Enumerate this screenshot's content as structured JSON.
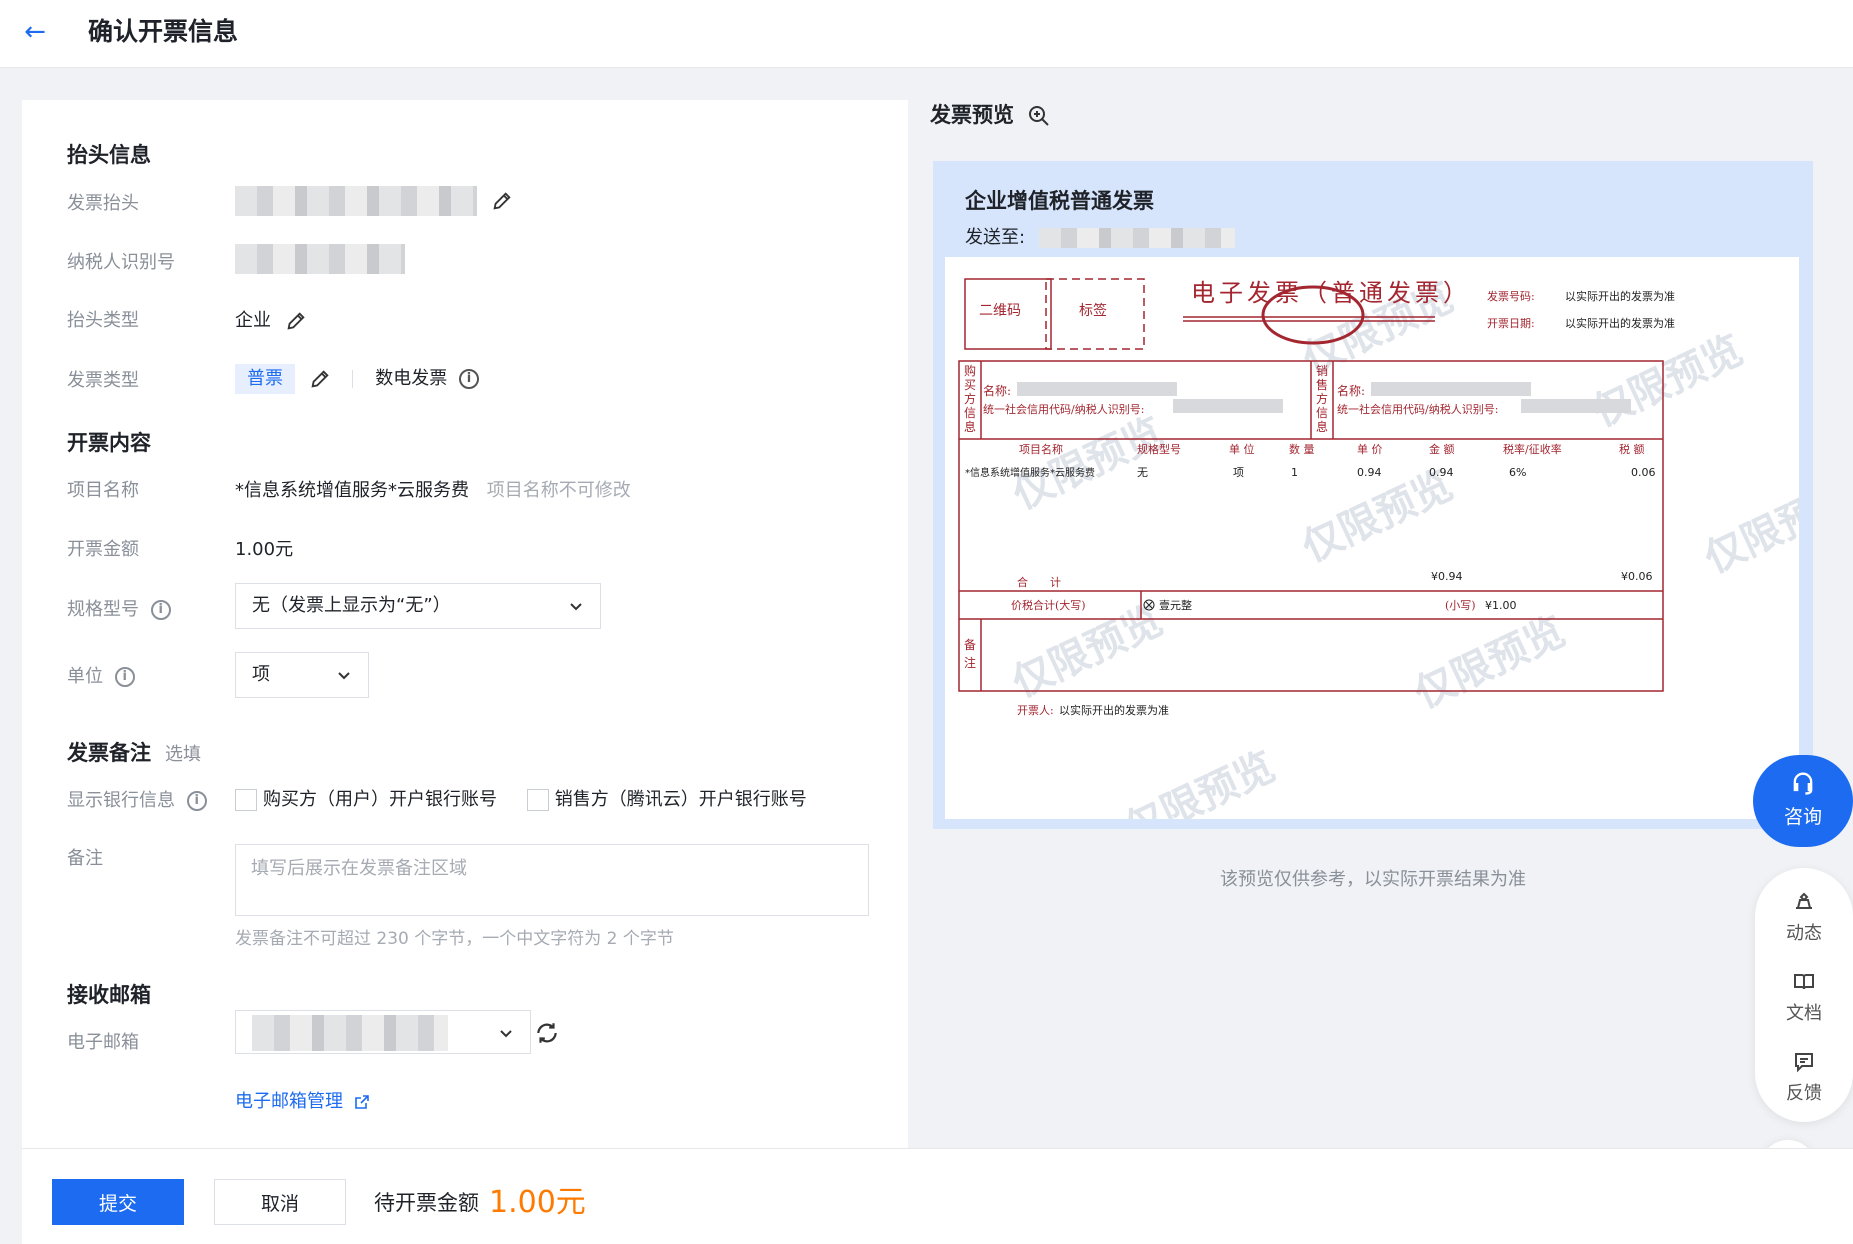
{
  "header": {
    "title": "确认开票信息"
  },
  "invoice_header": {
    "section_title": "抬头信息",
    "title_label": "发票抬头",
    "tax_id_label": "纳税人识别号",
    "type_label": "抬头类型",
    "type_value": "企业",
    "invoice_type_label": "发票类型",
    "invoice_type_tag": "普票",
    "invoice_type_value": "数电发票"
  },
  "content": {
    "section_title": "开票内容",
    "item_label": "项目名称",
    "item_value": "*信息系统增值服务*云服务费",
    "item_note": "项目名称不可修改",
    "amount_label": "开票金额",
    "amount_value": "1.00元",
    "spec_label": "规格型号",
    "spec_value": "无（发票上显示为“无”）",
    "unit_label": "单位",
    "unit_value": "项"
  },
  "remarks": {
    "section_title": "发票备注",
    "optional": "选填",
    "bank_label": "显示银行信息",
    "buyer_bank": "购买方（用户）开户银行账号",
    "seller_bank": "销售方（腾讯云）开户银行账号",
    "remark_label": "备注",
    "remark_placeholder": "填写后展示在发票备注区域",
    "remark_hint": "发票备注不可超过 230 个字节，一个中文字符为 2 个字节"
  },
  "email": {
    "section_title": "接收邮箱",
    "email_label": "电子邮箱",
    "manage_link": "电子邮箱管理"
  },
  "footer": {
    "submit": "提交",
    "cancel": "取消",
    "pending_label": "待开票金额",
    "pending_amount": "1.00元"
  },
  "preview": {
    "title": "发票预览",
    "card_title": "企业增值税普通发票",
    "send_to": "发送至:",
    "footnote": "该预览仅供参考，以实际开票结果为准",
    "invoice": {
      "qr": "二维码",
      "label_box": "标签",
      "heading": "电子发票（普通发票）",
      "no_label": "发票号码:",
      "no_value": "以实际开出的发票为准",
      "date_label": "开票日期:",
      "date_value": "以实际开出的发票为准",
      "buyer_side": "购买方信息",
      "seller_side": "销售方信息",
      "name_label": "名称:",
      "code_label": "统一社会信用代码/纳税人识别号:",
      "col_item": "项目名称",
      "col_spec": "规格型号",
      "col_unit": "单 位",
      "col_qty": "数 量",
      "col_price": "单 价",
      "col_amount": "金 额",
      "col_rate": "税率/征收率",
      "col_tax": "税 额",
      "row_item": "*信息系统增值服务*云服务费",
      "row_spec": "无",
      "row_unit": "项",
      "row_qty": "1",
      "row_price": "0.94",
      "row_amount": "0.94",
      "row_rate": "6%",
      "row_tax": "0.06",
      "total_label": "合　　计",
      "total_amount": "¥0.94",
      "total_tax": "¥0.06",
      "sum_label": "价税合计(大写)",
      "sum_upper": "壹元整",
      "sum_small_label": "(小写)",
      "sum_small": "¥1.00",
      "remark_side": "备注",
      "issuer_label": "开票人:",
      "issuer_value": "以实际开出的发票为准",
      "watermark": "仅限预览"
    }
  },
  "float": {
    "consult": "咨询",
    "news": "动态",
    "docs": "文档",
    "feedback": "反馈"
  },
  "colors": {
    "primary": "#1d6bf0",
    "invoice_red": "#a32630",
    "amount_orange": "#ff7a00"
  }
}
